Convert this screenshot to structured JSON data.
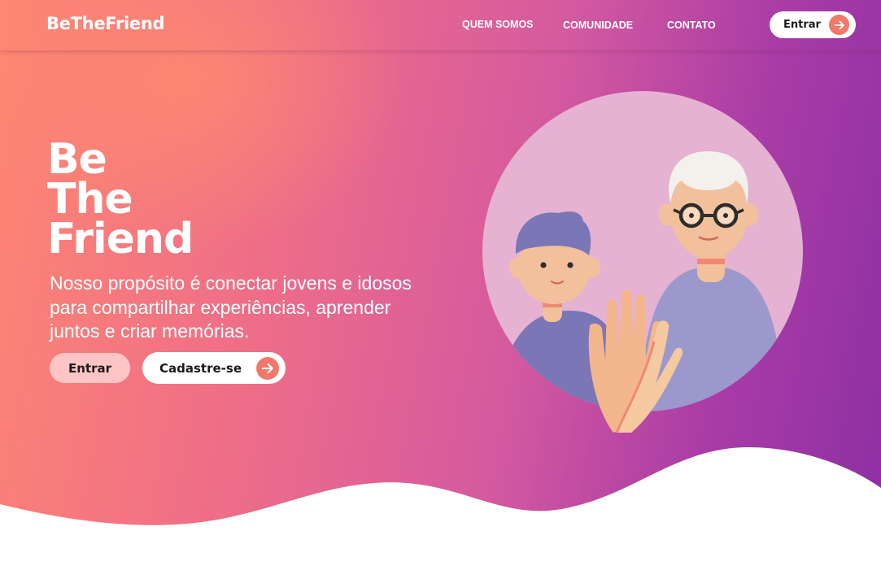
{
  "brand": {
    "logo": "BeTheFriend"
  },
  "nav": {
    "items": [
      {
        "label": "QUEM SOMOS"
      },
      {
        "label": "COMUNIDADE"
      },
      {
        "label": "CONTATO"
      }
    ],
    "login_label": "Entrar"
  },
  "hero": {
    "headline_lines": [
      "Be",
      "The",
      "Friend"
    ],
    "tagline": "Nosso propósito é conectar jovens e idosos para compartilhar experiências, aprender juntos e criar memórias.",
    "primary_button": "Entrar",
    "secondary_button": "Cadastre-se"
  },
  "icons": {
    "arrow": "arrow-right-icon",
    "illustration": "friends-high-five-illustration"
  },
  "colors": {
    "gradient_start": "#ff8672",
    "gradient_mid": "#e0609a",
    "gradient_end": "#8d2fa3",
    "accent": "#f2786a",
    "enter_button_bg": "#ffc5c5"
  }
}
